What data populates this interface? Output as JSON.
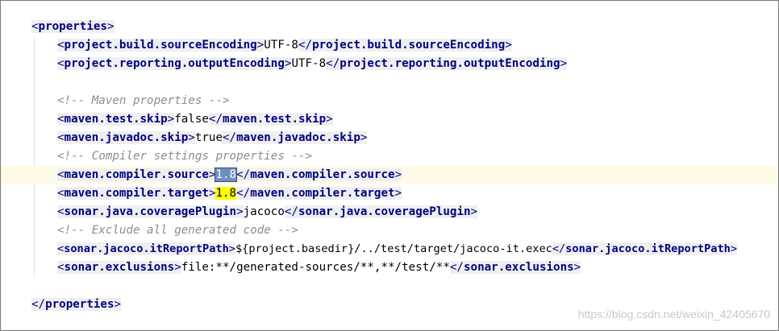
{
  "lines": {
    "l01_open": "properties",
    "l02_tag": "project.build.sourceEncoding",
    "l02_val": "UTF-8",
    "l03_tag": "project.reporting.outputEncoding",
    "l03_val": "UTF-8",
    "l05_comment": "<!-- Maven properties -->",
    "l06_tag": "maven.test.skip",
    "l06_val": "false",
    "l07_tag": "maven.javadoc.skip",
    "l07_val": "true",
    "l08_comment": "<!-- Compiler settings properties -->",
    "l09_tag": "maven.compiler.source",
    "l09_val": "1.8",
    "l10_tag": "maven.compiler.target",
    "l10_val": "1.8",
    "l11_tag": "sonar.java.coveragePlugin",
    "l11_val": "jacoco",
    "l12_comment": "<!-- Exclude all generated code -->",
    "l13_tag": "sonar.jacoco.itReportPath",
    "l13_val": "${project.basedir}/../test/target/jacoco-it.exec",
    "l14_tag": "sonar.exclusions",
    "l14_val": "file:**/generated-sources/**,**/test/**",
    "l16_close": "properties"
  },
  "watermark": "https://blog.csdn.net/weixin_42405670",
  "colors": {
    "tag": "#000080",
    "tag_bg": "#efefef",
    "comment": "#8c8c8c",
    "current_line": "#fefbe8",
    "selection": "#6f8fbf",
    "match_highlight": "#ffff00"
  }
}
